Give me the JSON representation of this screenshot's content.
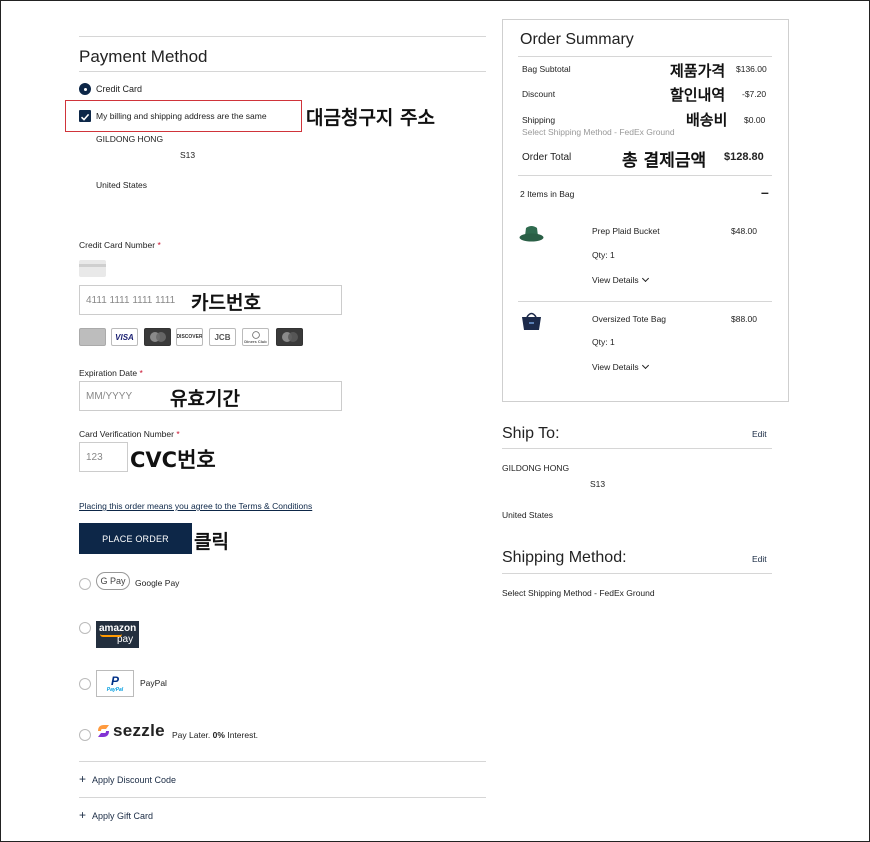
{
  "payment": {
    "title": "Payment Method",
    "credit_card_label": "Credit Card",
    "same_address_label": "My billing and shipping address are the same",
    "billing_name": "GILDONG HONG",
    "billing_line2": "S13",
    "billing_country": "United States",
    "annotation_billing": "대금청구지 주소",
    "card_number_label": "Credit Card Number",
    "required_mark": "*",
    "card_number_placeholder": "4111 1111 1111 1111",
    "annotation_card_number": "카드번호",
    "card_brands": [
      "VISA",
      "DISCOVER",
      "JCB",
      "Diners Club"
    ],
    "expiration_label": "Expiration Date",
    "expiration_placeholder": "MM/YYYY",
    "annotation_expiration": "유효기간",
    "cvc_label": "Card Verification Number",
    "cvc_placeholder": "123",
    "annotation_cvc": "CVC번호",
    "terms_text": "Placing this order means you agree to the Terms & Conditions",
    "place_order_label": "PLACE ORDER",
    "annotation_click": "클릭",
    "google_pay_badge": "G Pay",
    "google_pay_label": "Google Pay",
    "amazon_pay_line1": "amazon",
    "amazon_pay_line2": "pay",
    "paypal_badge": "PayPal",
    "paypal_label": "PayPal",
    "sezzle_logo": "sezzle",
    "sezzle_tagline_a": "Pay Later.",
    "sezzle_tagline_b": "0%",
    "sezzle_tagline_c": "Interest.",
    "apply_discount_label": "Apply Discount Code",
    "apply_gift_label": "Apply Gift Card"
  },
  "summary": {
    "title": "Order Summary",
    "subtotal_label": "Bag Subtotal",
    "subtotal_value": "$136.00",
    "annotation_subtotal": "제품가격",
    "discount_label": "Discount",
    "discount_value": "-$7.20",
    "annotation_discount": "할인내역",
    "shipping_label": "Shipping",
    "shipping_value": "$0.00",
    "annotation_shipping": "배송비",
    "shipping_method_note": "Select Shipping Method - FedEx Ground",
    "total_label": "Order Total",
    "total_value": "$128.80",
    "annotation_total": "총 결제금액",
    "items_in_bag": "2 Items in Bag",
    "collapse_symbol": "–",
    "items": [
      {
        "name": "Prep Plaid Bucket",
        "price": "$48.00",
        "qty": "Qty: 1",
        "details": "View Details"
      },
      {
        "name": "Oversized Tote Bag",
        "price": "$88.00",
        "qty": "Qty: 1",
        "details": "View Details"
      }
    ]
  },
  "ship_to": {
    "title": "Ship To:",
    "edit_label": "Edit",
    "name": "GILDONG HONG",
    "line2": "S13",
    "country": "United States"
  },
  "shipping_method": {
    "title": "Shipping Method:",
    "edit_label": "Edit",
    "value": "Select Shipping Method - FedEx Ground"
  },
  "colors": {
    "navy": "#0d2748",
    "highlight_red": "#d0343a",
    "hat_green": "#2f6b4f"
  }
}
